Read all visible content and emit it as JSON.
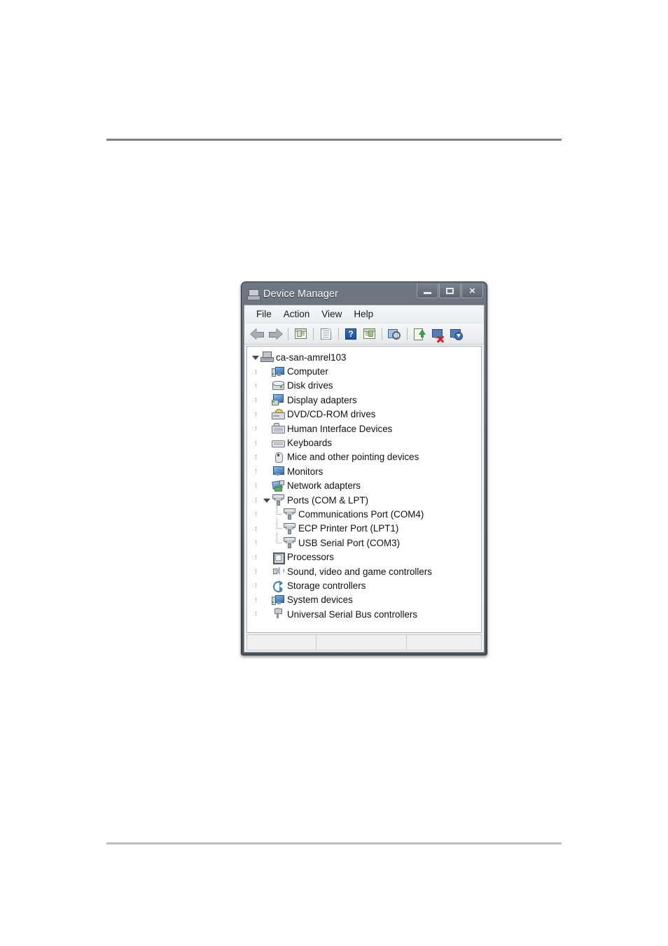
{
  "window": {
    "title": "Device Manager",
    "title_icon": "device-manager-icon",
    "buttons": {
      "minimize": "minimize-button",
      "maximize": "maximize-button",
      "close": "×"
    }
  },
  "menu": {
    "items": [
      {
        "label": "File"
      },
      {
        "label": "Action"
      },
      {
        "label": "View"
      },
      {
        "label": "Help"
      }
    ]
  },
  "toolbar": {
    "buttons": [
      {
        "name": "back-button",
        "icon": "arrow-left-icon"
      },
      {
        "name": "forward-button",
        "icon": "arrow-right-icon"
      },
      {
        "name": "show-hide-console-tree-button",
        "icon": "console-tree-icon"
      },
      {
        "name": "properties-button",
        "icon": "properties-document-icon"
      },
      {
        "name": "help-button",
        "icon": "question-mark-icon"
      },
      {
        "name": "show-hide-action-pane-button",
        "icon": "action-pane-icon"
      },
      {
        "name": "scan-for-hardware-changes-button",
        "icon": "scan-hardware-icon"
      },
      {
        "name": "update-driver-software-button",
        "icon": "update-driver-icon"
      },
      {
        "name": "disable-device-button",
        "icon": "disable-device-icon"
      },
      {
        "name": "uninstall-device-button",
        "icon": "install-device-icon"
      }
    ]
  },
  "tree": {
    "nodes": [
      {
        "label": "ca-san-amrel103",
        "level": 0,
        "state": "expanded",
        "icon": "computer-root-icon"
      },
      {
        "label": "Computer",
        "level": 1,
        "state": "collapsed",
        "icon": "computer-icon"
      },
      {
        "label": "Disk drives",
        "level": 1,
        "state": "collapsed",
        "icon": "disk-drive-icon"
      },
      {
        "label": "Display adapters",
        "level": 1,
        "state": "collapsed",
        "icon": "display-adapter-icon"
      },
      {
        "label": "DVD/CD-ROM drives",
        "level": 1,
        "state": "collapsed",
        "icon": "dvd-drive-icon"
      },
      {
        "label": "Human Interface Devices",
        "level": 1,
        "state": "collapsed",
        "icon": "human-interface-device-icon"
      },
      {
        "label": "Keyboards",
        "level": 1,
        "state": "collapsed",
        "icon": "keyboard-icon"
      },
      {
        "label": "Mice and other pointing devices",
        "level": 1,
        "state": "collapsed",
        "icon": "mouse-icon"
      },
      {
        "label": "Monitors",
        "level": 1,
        "state": "collapsed",
        "icon": "monitor-icon"
      },
      {
        "label": "Network adapters",
        "level": 1,
        "state": "collapsed",
        "icon": "network-adapter-icon"
      },
      {
        "label": "Ports (COM & LPT)",
        "level": 1,
        "state": "expanded",
        "icon": "port-icon"
      },
      {
        "label": "Communications Port (COM4)",
        "level": 2,
        "state": "leaf",
        "icon": "port-icon"
      },
      {
        "label": "ECP Printer Port (LPT1)",
        "level": 2,
        "state": "leaf",
        "icon": "port-icon"
      },
      {
        "label": "USB Serial Port (COM3)",
        "level": 2,
        "state": "leaf",
        "icon": "port-icon"
      },
      {
        "label": "Processors",
        "level": 1,
        "state": "collapsed",
        "icon": "processor-icon"
      },
      {
        "label": "Sound, video and game controllers",
        "level": 1,
        "state": "collapsed",
        "icon": "sound-controller-icon"
      },
      {
        "label": "Storage controllers",
        "level": 1,
        "state": "collapsed",
        "icon": "storage-controller-icon"
      },
      {
        "label": "System devices",
        "level": 1,
        "state": "collapsed",
        "icon": "system-device-icon"
      },
      {
        "label": "Universal Serial Bus controllers",
        "level": 1,
        "state": "collapsed",
        "icon": "usb-controller-icon"
      }
    ]
  },
  "status_bar": {
    "cells": [
      "",
      "",
      ""
    ]
  }
}
